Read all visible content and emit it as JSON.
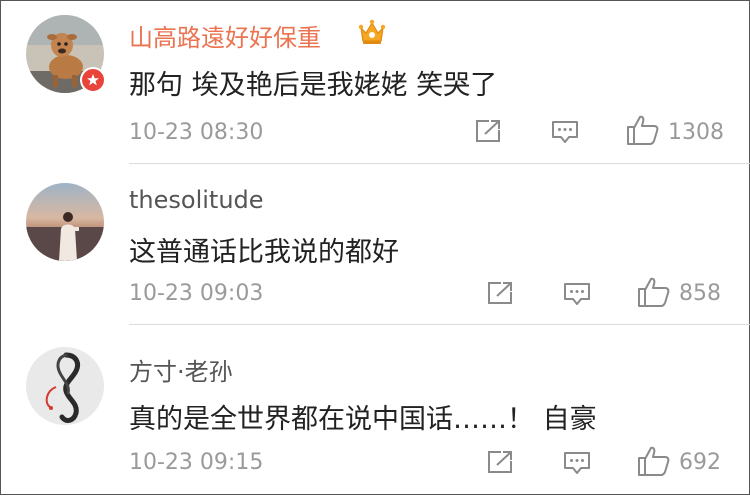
{
  "colors": {
    "vip_name": "#eb7350",
    "name": "#555555",
    "text": "#222222",
    "meta": "#9a9a9a",
    "verified_badge": "#e8443a",
    "crown": "#f5a623"
  },
  "comments": [
    {
      "username": "山高路遠好好保重",
      "vip_badge_icon": "crown-icon",
      "verified_icon": "verified-badge-icon",
      "text": "那句 埃及艳后是我姥姥 笑哭了",
      "time": "10-23 08:30",
      "likes": "1308"
    },
    {
      "username": "thesolitude",
      "text": "这普通话比我说的都好",
      "time": "10-23 09:03",
      "likes": "858"
    },
    {
      "username": "方寸·老孙",
      "text": "真的是全世界都在说中国话……！ 自豪",
      "time": "10-23 09:15",
      "likes": "692"
    }
  ],
  "action_icons": [
    "share-icon",
    "comment-icon",
    "like-icon"
  ]
}
